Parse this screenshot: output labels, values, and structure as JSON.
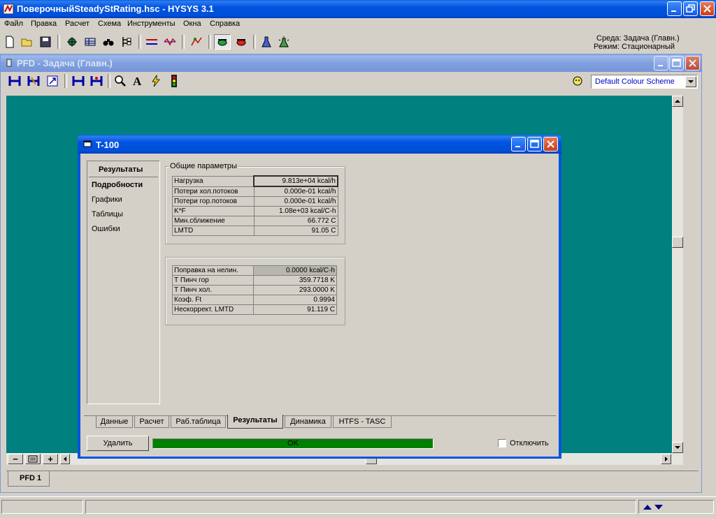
{
  "app": {
    "title": "ПоверочныйSteadyStRating.hsc - HYSYS 3.1",
    "menu": [
      "Файл",
      "Правка",
      "Расчет",
      "Схема",
      "Инструменты",
      "Окна",
      "Справка"
    ],
    "env_line1": "Среда: Задача (Главн.)",
    "env_line2": "Режим: Стационарный"
  },
  "pfd": {
    "title": "PFD - Задача (Главн.)",
    "colour_scheme": "Default Colour Scheme",
    "bottom_tab": "PFD 1",
    "zoom_minus": "−",
    "zoom_plus": "+"
  },
  "dialog": {
    "title": "T-100",
    "nav_header": "Результаты",
    "nav_items": [
      "Подробности",
      "Графики",
      "Таблицы",
      "Ошибки"
    ],
    "group1_label": "Общие параметры",
    "group1_rows": [
      {
        "label": "Нагрузка",
        "value": "9.813e+04 kcal/h"
      },
      {
        "label": "Потери хол.потоков",
        "value": "0.000e-01 kcal/h"
      },
      {
        "label": "Потери гор.потоков",
        "value": "0.000e-01 kcal/h"
      },
      {
        "label": "K*F",
        "value": "1.08e+03 kcal/C-h"
      },
      {
        "label": "Мин.сближение",
        "value": "66.772 C"
      },
      {
        "label": "LMTD",
        "value": "91.05 C"
      }
    ],
    "group2_rows": [
      {
        "label": "Поправка на нелин.",
        "value": "0.0000 kcal/C-h"
      },
      {
        "label": "Т Пинч гор",
        "value": "359.7718 K"
      },
      {
        "label": "Т Пинч хол.",
        "value": "293.0000 K"
      },
      {
        "label": "Коэф. Ft",
        "value": "0.9994"
      },
      {
        "label": "Нескоррект. LMTD",
        "value": "91.119 C"
      }
    ],
    "tabs": [
      "Данные",
      "Расчет",
      "Раб.таблица",
      "Результаты",
      "Динамика",
      "HTFS - TASC"
    ],
    "active_tab": "Результаты",
    "delete_button": "Удалить",
    "status_text": "OK",
    "disable_label": "Отключить"
  },
  "colors": {
    "pfd_background": "#00807f",
    "status_ok": "#008000",
    "window_bg": "#d4d0c8"
  }
}
